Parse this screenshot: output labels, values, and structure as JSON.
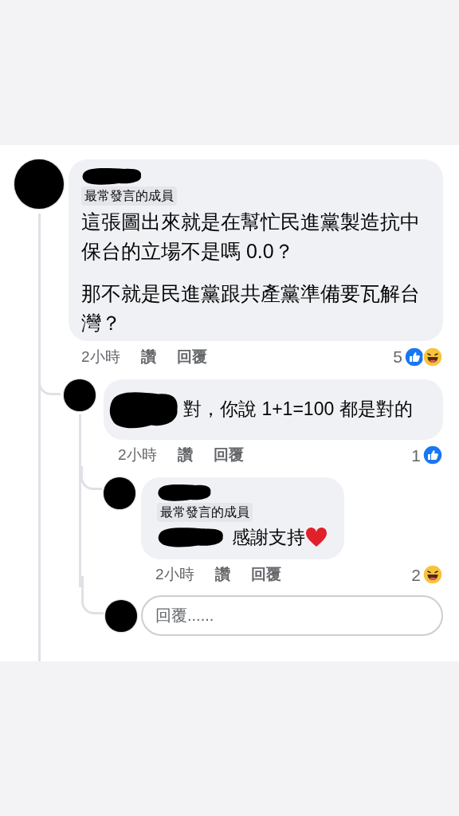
{
  "comment": {
    "badge": "最常發言的成員",
    "paragraphs": [
      "這張圖出來就是在幫忙民進黨製造抗中保台的立場不是嗎 0.0？",
      "那不就是民進黨跟共產黨準備要瓦解台灣？"
    ],
    "time": "2小時",
    "actions": [
      "讚",
      "回覆"
    ],
    "reaction_count": "5",
    "reactions": [
      {
        "kind": "like"
      },
      {
        "kind": "haha"
      }
    ]
  },
  "replies": [
    {
      "text": "對，你說 1+1=100 都是對的",
      "time": "2小時",
      "actions": [
        "讚",
        "回覆"
      ],
      "reaction_count": "1",
      "reactions": [
        {
          "kind": "like"
        }
      ]
    },
    {
      "badge": "最常發言的成員",
      "text": "感謝支持",
      "time": "2小時",
      "actions": [
        "讚",
        "回覆"
      ],
      "reaction_count": "2",
      "reactions": [
        {
          "kind": "haha"
        }
      ]
    }
  ],
  "reply_field": {
    "placeholder": "回覆......"
  }
}
